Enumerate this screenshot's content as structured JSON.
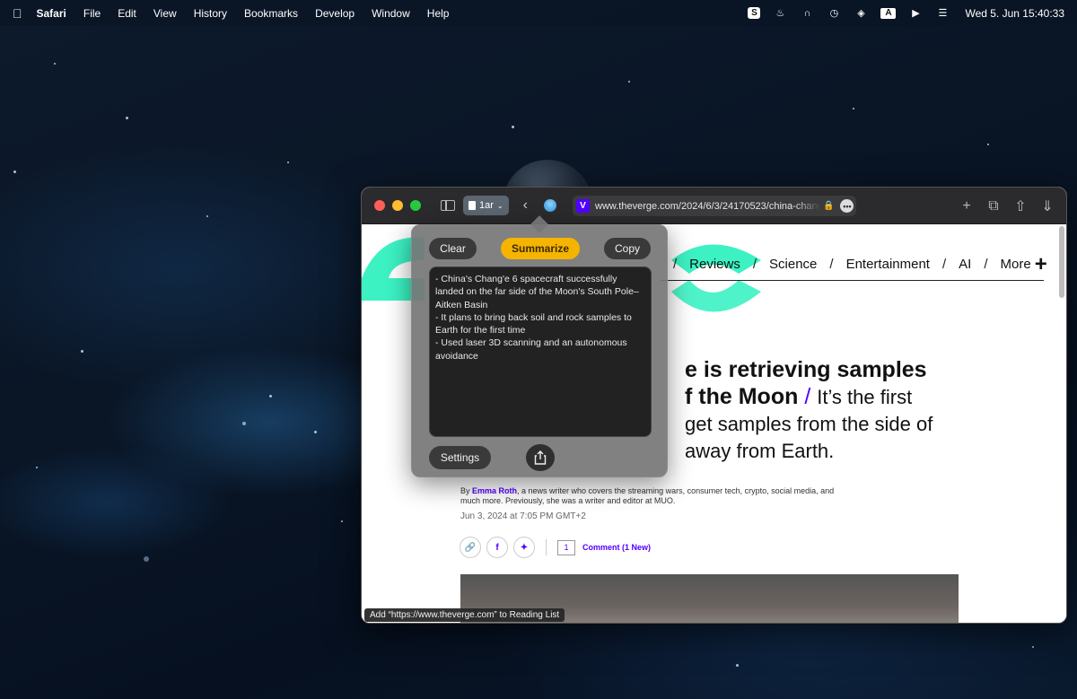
{
  "menubar": {
    "apple_icon": "apple-logo-icon",
    "items": [
      "Safari",
      "File",
      "Edit",
      "View",
      "History",
      "Bookmarks",
      "Develop",
      "Window",
      "Help"
    ],
    "status_icons": [
      {
        "name": "s-app-icon",
        "glyph": "S"
      },
      {
        "name": "flame-icon",
        "glyph": "♨"
      },
      {
        "name": "headphones-icon",
        "glyph": "∩"
      },
      {
        "name": "time-machine-icon",
        "glyph": "◷"
      },
      {
        "name": "stack-icon",
        "glyph": "◈"
      },
      {
        "name": "input-source-icon",
        "glyph": "A"
      },
      {
        "name": "play-icon",
        "glyph": "▶"
      },
      {
        "name": "control-center-icon",
        "glyph": "☰"
      }
    ],
    "clock": "Wed 5. Jun  15:40:33"
  },
  "browser": {
    "tab_group_label": "1ar",
    "address": {
      "favicon": "V",
      "url": "www.theverge.com/2024/6/3/24170523/china-chang",
      "more_glyph": "•••"
    },
    "status_tip": "Add “https://www.theverge.com” to Reading List"
  },
  "article": {
    "nav": [
      "Reviews",
      "Science",
      "Entertainment",
      "AI",
      "More"
    ],
    "headline_bold_1": "e is retrieving samples",
    "headline_bold_2": "f the Moon",
    "headline_slash": "/",
    "headline_dek_1": "It’s the first",
    "headline_dek_2": "get samples from the side of",
    "headline_dek_3": "away from Earth.",
    "byline_prefix": "By ",
    "author": "Emma Roth",
    "byline_rest": ", a news writer who covers the streaming wars, consumer tech, crypto, social media, and much more. Previously, she was a writer and editor at MUO.",
    "date": "Jun 3, 2024 at 7:05 PM GMT+2",
    "comment_count": "1",
    "comment_link": "Comment (1 New)"
  },
  "popover": {
    "clear_label": "Clear",
    "summarize_label": "Summarize",
    "copy_label": "Copy",
    "summary_text": "- China's Chang'e 6 spacecraft successfully landed on the far side of the Moon's South Pole–Aitken Basin\n- It plans to bring back soil and rock samples to Earth for the first time\n- Used laser 3D scanning and an autonomous avoidance",
    "settings_label": "Settings"
  },
  "colors": {
    "summarize_accent": "#f5b400",
    "verge_purple": "#5200ff",
    "verge_mint": "#3cf2c3"
  }
}
